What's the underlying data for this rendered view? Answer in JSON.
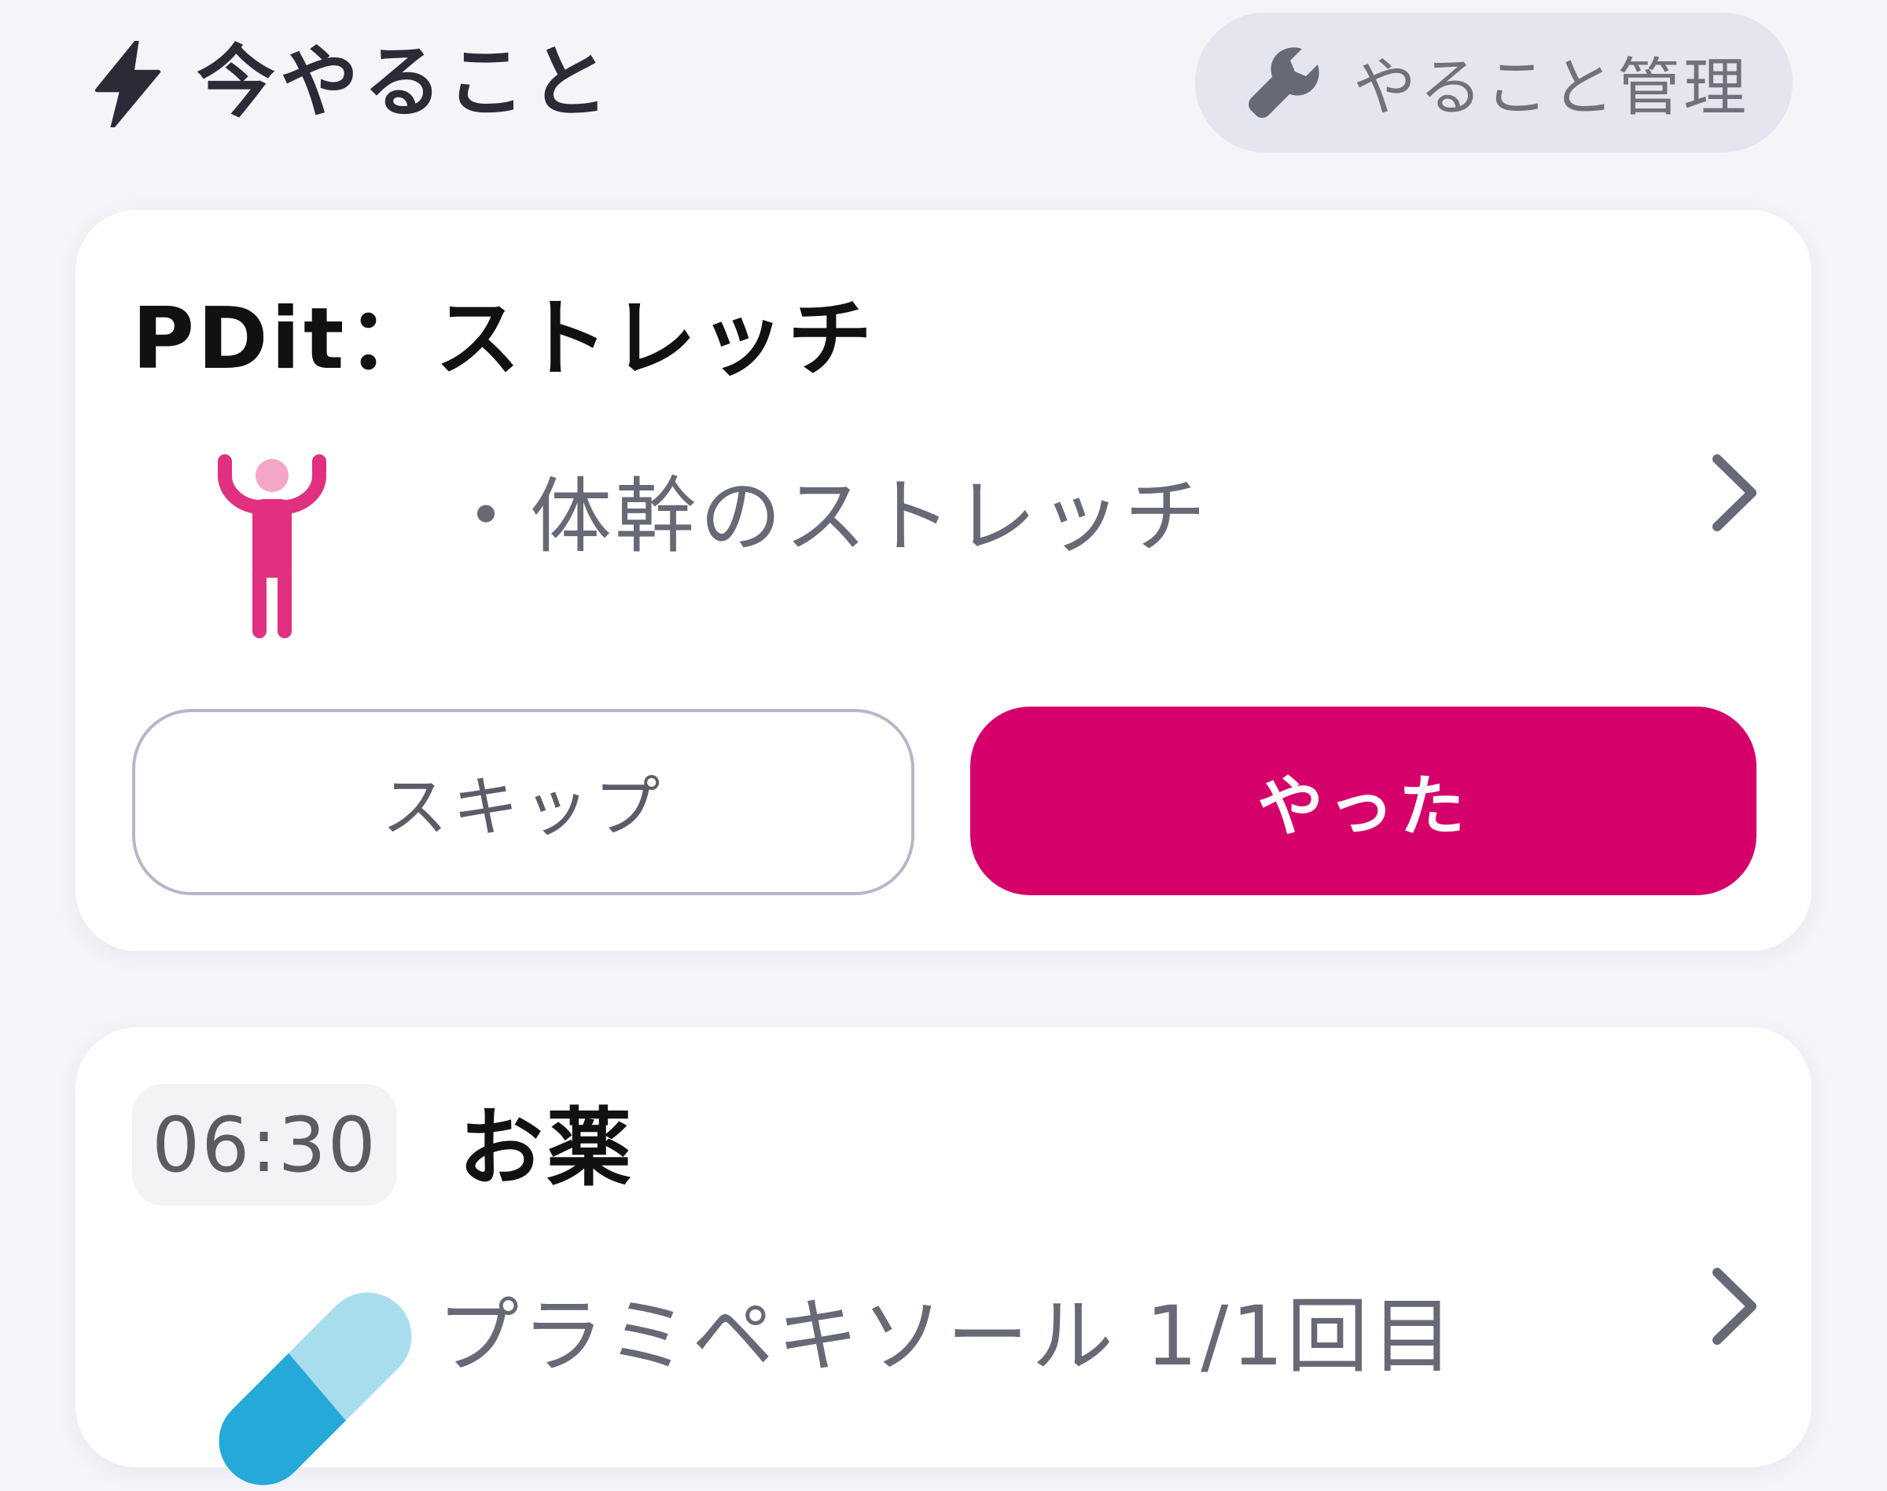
{
  "header": {
    "title": "今やること",
    "title_icon": "lightning-icon",
    "manage_button": {
      "label": "やること管理",
      "icon": "wrench-icon"
    }
  },
  "colors": {
    "accent": "#d6006b",
    "figure_pink": "#e0307f",
    "figure_head": "#f3a6c8",
    "pill_light": "#a8ddee",
    "pill_dark": "#24a9d9",
    "text_dark": "#111111",
    "text_gray": "#686977"
  },
  "cards": [
    {
      "title": "PDit：ストレッチ",
      "items": [
        {
          "icon": "person-stretch-icon",
          "text": "・体幹のストレッチ"
        }
      ],
      "actions": {
        "skip_label": "スキップ",
        "done_label": "やった"
      }
    },
    {
      "time": "06:30",
      "title": "お薬",
      "items": [
        {
          "icon": "pill-capsule-icon",
          "text": "プラミペキソール 1/1回目"
        }
      ]
    }
  ]
}
